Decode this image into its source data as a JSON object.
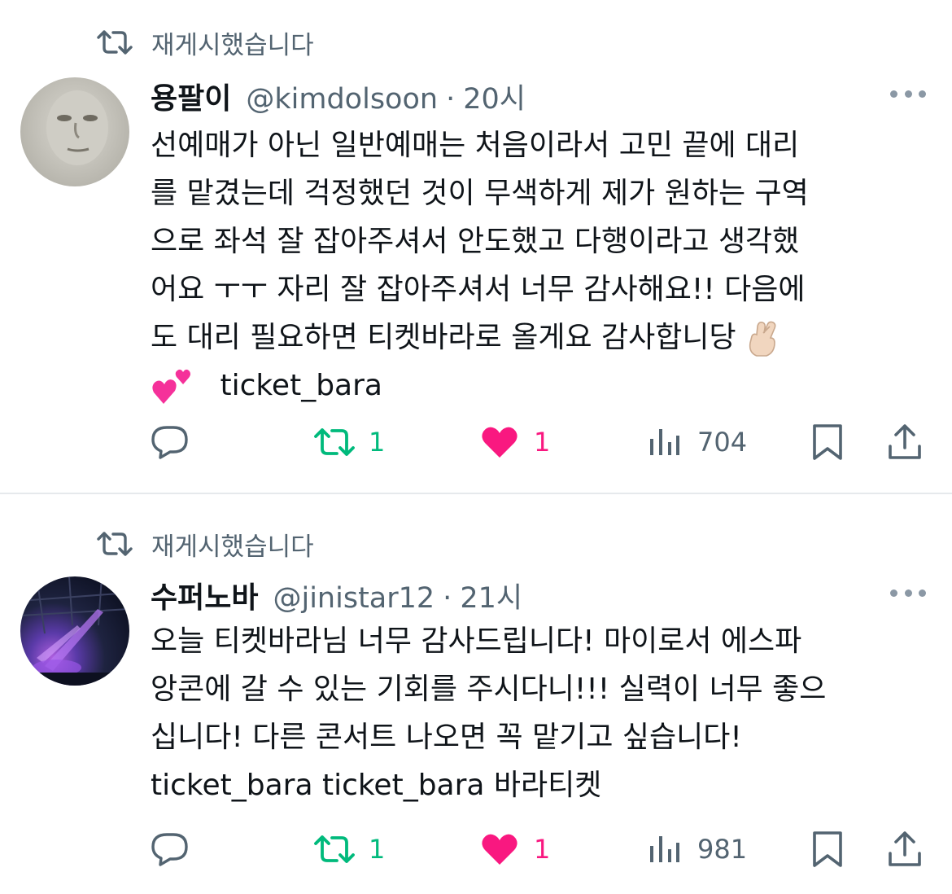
{
  "colors": {
    "text_primary": "#0f1419",
    "text_secondary": "#536471",
    "repost_active": "#00ba7c",
    "like_active": "#f91880",
    "divider": "#e6e9ec"
  },
  "tweets": [
    {
      "repost_label": "재게시했습니다",
      "avatar": "plain-face-photo",
      "display_name": "용팔이",
      "handle": "@kimdolsoon",
      "separator": "·",
      "time": "20시",
      "body_lines": [
        "선예매가 아닌 일반예매는 처음이라서 고민 끝에 대리",
        "를 맡겼는데 걱정했던 것이 무색하게 제가 원하는 구역",
        "으로 좌석 잘 잡아주셔서 안도했고 다행이라고 생각했",
        "어요 ㅜㅜ 자리 잘 잡아주셔서 너무 감사해요!! 다음에",
        "도 대리 필요하면 티켓바라로 올게요 감사합니당",
        "ticket_bara"
      ],
      "emojis": [
        "crossed-fingers-emoji",
        "two-hearts-emoji"
      ],
      "actions": {
        "reply_count": "",
        "repost_count": "1",
        "like_count": "1",
        "view_count": "704"
      }
    },
    {
      "repost_label": "재게시했습니다",
      "avatar": "concert-stage-photo",
      "display_name": "수퍼노바",
      "handle": "@jinistar12",
      "separator": "·",
      "time": "21시",
      "body_lines": [
        "오늘 티켓바라님 너무 감사드립니다! 마이로서 에스파",
        "앙콘에 갈 수 있는 기회를 주시다니!!! 실력이 너무 좋으",
        "십니다! 다른 콘서트 나오면 꼭 맡기고 싶습니다!",
        "ticket_bara ticket_bara 바라티켓"
      ],
      "actions": {
        "reply_count": "",
        "repost_count": "1",
        "like_count": "1",
        "view_count": "981"
      }
    }
  ]
}
